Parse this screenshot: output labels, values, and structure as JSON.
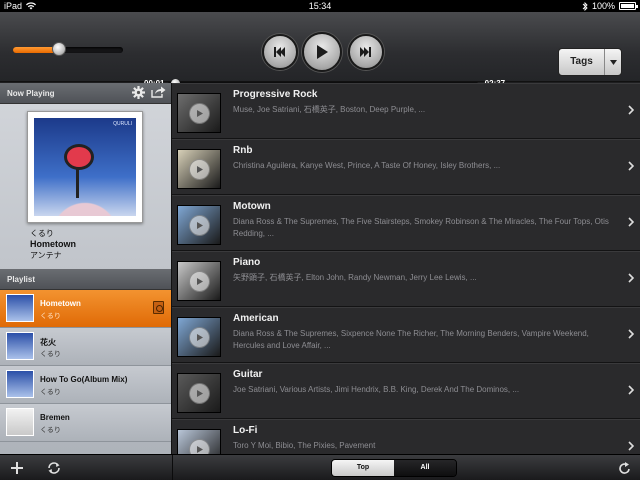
{
  "status": {
    "carrier": "iPad",
    "time": "15:34",
    "battery": "100%"
  },
  "player": {
    "elapsed": "00:01",
    "remaining": "-02:37",
    "volume": 0.4,
    "progress": 0.01
  },
  "tags_button": {
    "label": "Tags"
  },
  "now_playing": {
    "header": "Now Playing",
    "band_logo": "QURULI",
    "artist": "くるり",
    "title": "Hometown",
    "album": "アンテナ"
  },
  "playlist": {
    "header": "Playlist",
    "items": [
      {
        "name": "Hometown",
        "artist": "くるり",
        "active": true
      },
      {
        "name": "花火",
        "artist": "くるり",
        "active": false
      },
      {
        "name": "How To Go(Album Mix)",
        "artist": "くるり",
        "active": false
      },
      {
        "name": "Bremen",
        "artist": "くるり",
        "active": false
      }
    ]
  },
  "tags": [
    {
      "name": "Progressive Rock",
      "artists": "Muse, Joe Satriani, 石橋英子, Boston, Deep Purple, ...",
      "thumb": "#6d6d6d"
    },
    {
      "name": "Rnb",
      "artists": "Christina Aguilera, Kanye West, Prince, A Taste Of Honey, Isley Brothers, ...",
      "thumb": "#d7d0b8"
    },
    {
      "name": "Motown",
      "artists": "Diana Ross & The Supremes, The Five Stairsteps, Smokey Robinson & The Miracles, The Four Tops, Otis Redding, ...",
      "thumb": "#7fa7d4"
    },
    {
      "name": "Piano",
      "artists": "矢野顕子, 石橋英子, Elton John, Randy Newman, Jerry Lee Lewis, ...",
      "thumb": "#c8c8c8"
    },
    {
      "name": "American",
      "artists": "Diana Ross & The Supremes, Sixpence None The Richer, The Morning Benders, Vampire Weekend, Hercules and Love Affair, ...",
      "thumb": "#7fa7d4"
    },
    {
      "name": "Guitar",
      "artists": "Joe Satriani, Various Artists, Jimi Hendrix, B.B. King, Derek And The Dominos, ...",
      "thumb": "#5a5a5a"
    },
    {
      "name": "Lo-Fi",
      "artists": "Toro Y Moi, Bibio, The Pixies, Pavement",
      "thumb": "#b9c6d8"
    }
  ],
  "segments": {
    "top": "Top",
    "all": "All"
  },
  "colors": {
    "accent": "#e8730a",
    "background": "#2a2a2c"
  }
}
